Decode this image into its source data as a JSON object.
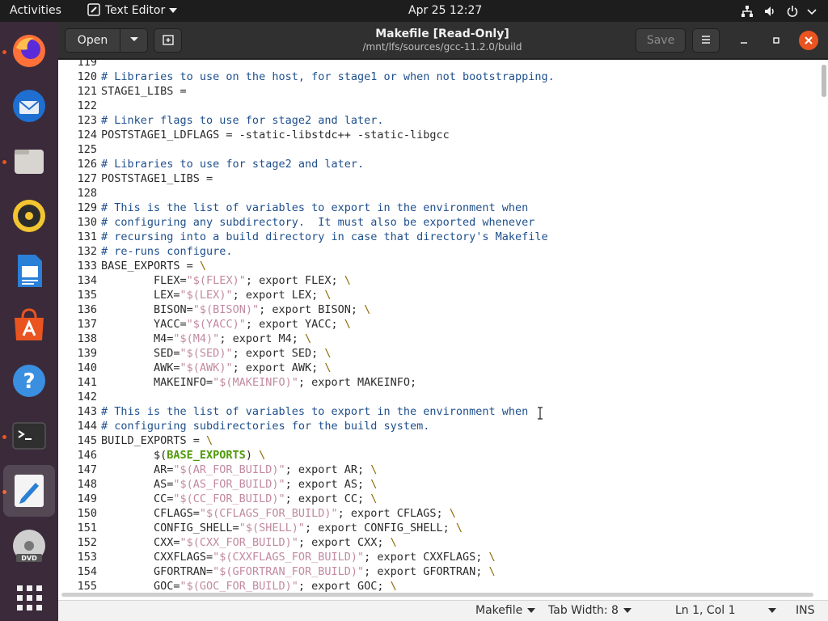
{
  "topbar": {
    "activities": "Activities",
    "app_name": "Text Editor",
    "clock": "Apr 25  12:27",
    "icons": [
      "network-icon",
      "volume-icon",
      "power-icon",
      "chevron-down-icon"
    ]
  },
  "dock": {
    "items": [
      {
        "name": "firefox-icon",
        "running": true
      },
      {
        "name": "thunderbird-icon",
        "running": false
      },
      {
        "name": "files-icon",
        "running": true
      },
      {
        "name": "rhythmbox-icon",
        "running": false
      },
      {
        "name": "writer-icon",
        "running": false
      },
      {
        "name": "software-icon",
        "running": false
      },
      {
        "name": "help-icon",
        "running": false
      },
      {
        "name": "terminal-icon",
        "running": true
      },
      {
        "name": "text-editor-icon",
        "running": true,
        "active": true
      },
      {
        "name": "dvd-icon",
        "running": false
      },
      {
        "name": "show-apps-icon",
        "running": false
      }
    ]
  },
  "header": {
    "open_label": "Open",
    "save_label": "Save",
    "title": "Makefile [Read-Only]",
    "path": "/mnt/lfs/sources/gcc-11.2.0/build"
  },
  "editor": {
    "lines": [
      {
        "n": "119",
        "segs": []
      },
      {
        "n": "120",
        "segs": [
          {
            "c": "cm",
            "t": "# Libraries to use on the host, for stage1 or when not bootstrapping."
          }
        ]
      },
      {
        "n": "121",
        "segs": [
          {
            "c": "",
            "t": "STAGE1_LIBS ="
          }
        ]
      },
      {
        "n": "122",
        "segs": []
      },
      {
        "n": "123",
        "segs": [
          {
            "c": "cm",
            "t": "# Linker flags to use for stage2 and later."
          }
        ]
      },
      {
        "n": "124",
        "segs": [
          {
            "c": "",
            "t": "POSTSTAGE1_LDFLAGS = -static-libstdc++ -static-libgcc"
          }
        ]
      },
      {
        "n": "125",
        "segs": []
      },
      {
        "n": "126",
        "segs": [
          {
            "c": "cm",
            "t": "# Libraries to use for stage2 and later."
          }
        ]
      },
      {
        "n": "127",
        "segs": [
          {
            "c": "",
            "t": "POSTSTAGE1_LIBS ="
          }
        ]
      },
      {
        "n": "128",
        "segs": []
      },
      {
        "n": "129",
        "segs": [
          {
            "c": "cm",
            "t": "# This is the list of variables to export in the environment when"
          }
        ]
      },
      {
        "n": "130",
        "segs": [
          {
            "c": "cm",
            "t": "# configuring any subdirectory.  It must also be exported whenever"
          }
        ]
      },
      {
        "n": "131",
        "segs": [
          {
            "c": "cm",
            "t": "# recursing into a build directory in case that directory's Makefile"
          }
        ]
      },
      {
        "n": "132",
        "segs": [
          {
            "c": "cm",
            "t": "# re-runs configure."
          }
        ]
      },
      {
        "n": "133",
        "segs": [
          {
            "c": "",
            "t": "BASE_EXPORTS = "
          },
          {
            "c": "bs",
            "t": "\\"
          }
        ]
      },
      {
        "n": "134",
        "segs": [
          {
            "c": "",
            "t": "        FLEX="
          },
          {
            "c": "st",
            "t": "\"$(FLEX)\""
          },
          {
            "c": "",
            "t": "; export FLEX; "
          },
          {
            "c": "bs",
            "t": "\\"
          }
        ]
      },
      {
        "n": "135",
        "segs": [
          {
            "c": "",
            "t": "        LEX="
          },
          {
            "c": "st",
            "t": "\"$(LEX)\""
          },
          {
            "c": "",
            "t": "; export LEX; "
          },
          {
            "c": "bs",
            "t": "\\"
          }
        ]
      },
      {
        "n": "136",
        "segs": [
          {
            "c": "",
            "t": "        BISON="
          },
          {
            "c": "st",
            "t": "\"$(BISON)\""
          },
          {
            "c": "",
            "t": "; export BISON; "
          },
          {
            "c": "bs",
            "t": "\\"
          }
        ]
      },
      {
        "n": "137",
        "segs": [
          {
            "c": "",
            "t": "        YACC="
          },
          {
            "c": "st",
            "t": "\"$(YACC)\""
          },
          {
            "c": "",
            "t": "; export YACC; "
          },
          {
            "c": "bs",
            "t": "\\"
          }
        ]
      },
      {
        "n": "138",
        "segs": [
          {
            "c": "",
            "t": "        M4="
          },
          {
            "c": "st",
            "t": "\"$(M4)\""
          },
          {
            "c": "",
            "t": "; export M4; "
          },
          {
            "c": "bs",
            "t": "\\"
          }
        ]
      },
      {
        "n": "139",
        "segs": [
          {
            "c": "",
            "t": "        SED="
          },
          {
            "c": "st",
            "t": "\"$(SED)\""
          },
          {
            "c": "",
            "t": "; export SED; "
          },
          {
            "c": "bs",
            "t": "\\"
          }
        ]
      },
      {
        "n": "140",
        "segs": [
          {
            "c": "",
            "t": "        AWK="
          },
          {
            "c": "st",
            "t": "\"$(AWK)\""
          },
          {
            "c": "",
            "t": "; export AWK; "
          },
          {
            "c": "bs",
            "t": "\\"
          }
        ]
      },
      {
        "n": "141",
        "segs": [
          {
            "c": "",
            "t": "        MAKEINFO="
          },
          {
            "c": "st",
            "t": "\"$(MAKEINFO)\""
          },
          {
            "c": "",
            "t": "; export MAKEINFO;"
          }
        ]
      },
      {
        "n": "142",
        "segs": []
      },
      {
        "n": "143",
        "segs": [
          {
            "c": "cm",
            "t": "# This is the list of variables to export in the environment when"
          }
        ]
      },
      {
        "n": "144",
        "segs": [
          {
            "c": "cm",
            "t": "# configuring subdirectories for the build system."
          }
        ]
      },
      {
        "n": "145",
        "segs": [
          {
            "c": "",
            "t": "BUILD_EXPORTS = "
          },
          {
            "c": "bs",
            "t": "\\"
          }
        ]
      },
      {
        "n": "146",
        "segs": [
          {
            "c": "",
            "t": "        $("
          },
          {
            "c": "kw",
            "t": "BASE_EXPORTS"
          },
          {
            "c": "",
            "t": ") "
          },
          {
            "c": "bs",
            "t": "\\"
          }
        ]
      },
      {
        "n": "147",
        "segs": [
          {
            "c": "",
            "t": "        AR="
          },
          {
            "c": "st",
            "t": "\"$(AR_FOR_BUILD)\""
          },
          {
            "c": "",
            "t": "; export AR; "
          },
          {
            "c": "bs",
            "t": "\\"
          }
        ]
      },
      {
        "n": "148",
        "segs": [
          {
            "c": "",
            "t": "        AS="
          },
          {
            "c": "st",
            "t": "\"$(AS_FOR_BUILD)\""
          },
          {
            "c": "",
            "t": "; export AS; "
          },
          {
            "c": "bs",
            "t": "\\"
          }
        ]
      },
      {
        "n": "149",
        "segs": [
          {
            "c": "",
            "t": "        CC="
          },
          {
            "c": "st",
            "t": "\"$(CC_FOR_BUILD)\""
          },
          {
            "c": "",
            "t": "; export CC; "
          },
          {
            "c": "bs",
            "t": "\\"
          }
        ]
      },
      {
        "n": "150",
        "segs": [
          {
            "c": "",
            "t": "        CFLAGS="
          },
          {
            "c": "st",
            "t": "\"$(CFLAGS_FOR_BUILD)\""
          },
          {
            "c": "",
            "t": "; export CFLAGS; "
          },
          {
            "c": "bs",
            "t": "\\"
          }
        ]
      },
      {
        "n": "151",
        "segs": [
          {
            "c": "",
            "t": "        CONFIG_SHELL="
          },
          {
            "c": "st",
            "t": "\"$(SHELL)\""
          },
          {
            "c": "",
            "t": "; export CONFIG_SHELL; "
          },
          {
            "c": "bs",
            "t": "\\"
          }
        ]
      },
      {
        "n": "152",
        "segs": [
          {
            "c": "",
            "t": "        CXX="
          },
          {
            "c": "st",
            "t": "\"$(CXX_FOR_BUILD)\""
          },
          {
            "c": "",
            "t": "; export CXX; "
          },
          {
            "c": "bs",
            "t": "\\"
          }
        ]
      },
      {
        "n": "153",
        "segs": [
          {
            "c": "",
            "t": "        CXXFLAGS="
          },
          {
            "c": "st",
            "t": "\"$(CXXFLAGS_FOR_BUILD)\""
          },
          {
            "c": "",
            "t": "; export CXXFLAGS; "
          },
          {
            "c": "bs",
            "t": "\\"
          }
        ]
      },
      {
        "n": "154",
        "segs": [
          {
            "c": "",
            "t": "        GFORTRAN="
          },
          {
            "c": "st",
            "t": "\"$(GFORTRAN_FOR_BUILD)\""
          },
          {
            "c": "",
            "t": "; export GFORTRAN; "
          },
          {
            "c": "bs",
            "t": "\\"
          }
        ]
      },
      {
        "n": "155",
        "segs": [
          {
            "c": "",
            "t": "        GOC="
          },
          {
            "c": "st",
            "t": "\"$(GOC_FOR_BUILD)\""
          },
          {
            "c": "",
            "t": "; export GOC; "
          },
          {
            "c": "bs",
            "t": "\\"
          }
        ]
      }
    ]
  },
  "statusbar": {
    "language": "Makefile",
    "tab_width": "Tab Width: 8",
    "position": "Ln 1, Col 1",
    "mode": "INS"
  },
  "colors": {
    "accent": "#e95420",
    "comment": "#1e4f8c",
    "string": "#c28aa0",
    "keyword": "#4e9a06",
    "dock_bg": "#3a2a3a",
    "topbar_bg": "#1d1d1d"
  }
}
